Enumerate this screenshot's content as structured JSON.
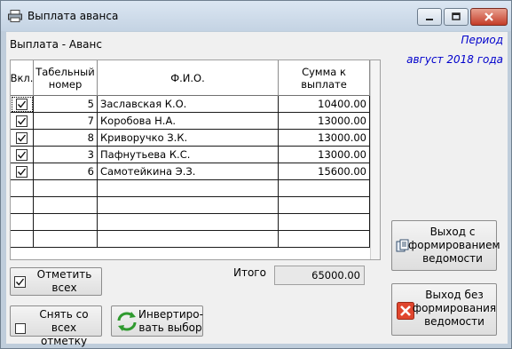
{
  "window": {
    "title": "Выплата аванса",
    "icon": "printer-icon"
  },
  "form": {
    "heading": "Выплата - Аванс",
    "period_label": "Период",
    "period_value": "август 2018 года"
  },
  "table": {
    "columns": [
      "Вкл.",
      "Табельный номер",
      "Ф.И.О.",
      "Сумма к выплате"
    ],
    "rows": [
      {
        "checked": true,
        "number": "5",
        "name": "Заславская К.О.",
        "amount": "10400.00"
      },
      {
        "checked": true,
        "number": "7",
        "name": "Коробова Н.А.",
        "amount": "13000.00"
      },
      {
        "checked": true,
        "number": "8",
        "name": "Криворучко З.К.",
        "amount": "13000.00"
      },
      {
        "checked": true,
        "number": "3",
        "name": "Пафнутьева К.С.",
        "amount": "13000.00"
      },
      {
        "checked": true,
        "number": "6",
        "name": "Самотейкина Э.З.",
        "amount": "15600.00"
      }
    ]
  },
  "total": {
    "label": "Итого",
    "value": "65000.00"
  },
  "buttons": {
    "mark_all": "Отметить всех",
    "clear_all": "Снять со всех отметку",
    "invert": "Инвертиро-вать выбор",
    "exit_with": "Выход с формированием ведомости",
    "exit_without": "Выход без формирования ведомости"
  },
  "colors": {
    "period_text": "#0000cc",
    "close_button": "#c43c28",
    "invert_icon": "#2f9a2f"
  }
}
